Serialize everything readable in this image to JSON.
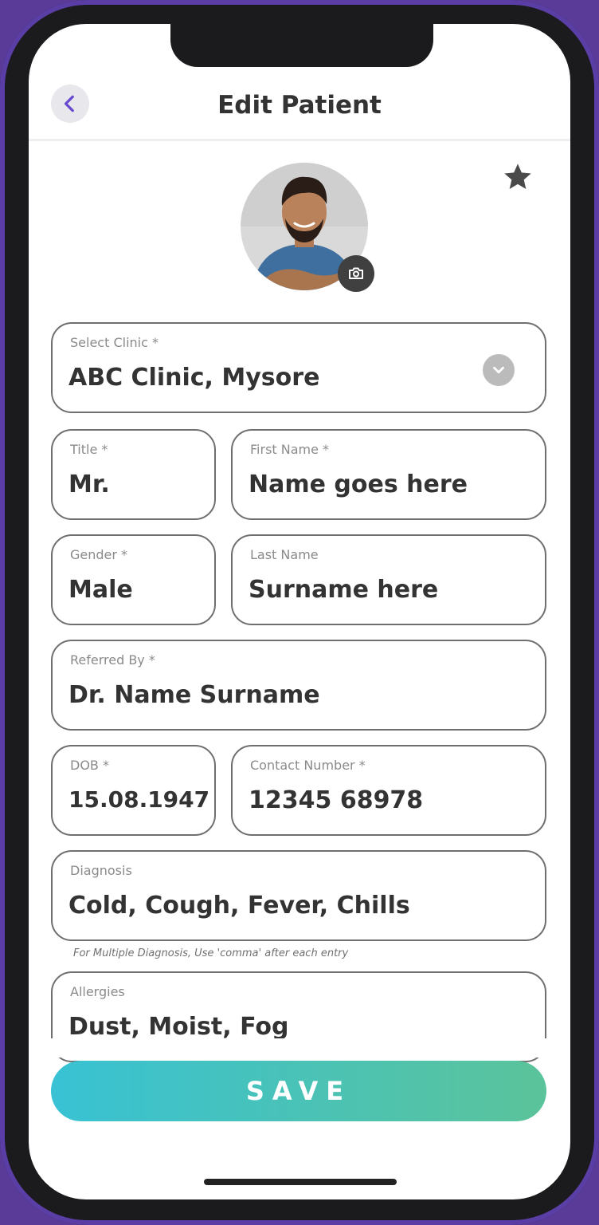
{
  "header": {
    "title": "Edit Patient"
  },
  "form": {
    "clinic": {
      "label": "Select Clinic *",
      "value": "ABC Clinic, Mysore"
    },
    "title": {
      "label": "Title *",
      "value": "Mr."
    },
    "first_name": {
      "label": "First Name *",
      "value": "Name goes here"
    },
    "gender": {
      "label": "Gender *",
      "value": "Male"
    },
    "last_name": {
      "label": "Last Name",
      "value": "Surname here"
    },
    "referred_by": {
      "label": "Referred By *",
      "value": "Dr. Name Surname"
    },
    "dob": {
      "label": "DOB *",
      "value": "15.08.1947"
    },
    "contact": {
      "label": "Contact Number *",
      "value": "12345 68978"
    },
    "diagnosis": {
      "label": "Diagnosis",
      "value": "Cold, Cough, Fever, Chills"
    },
    "diagnosis_hint": "For Multiple Diagnosis, Use 'comma' after each entry",
    "allergies": {
      "label": "Allergies",
      "value": "Dust, Moist, Fog"
    }
  },
  "actions": {
    "save_label": "SAVE"
  },
  "icons": {
    "back": "chevron-left-icon",
    "favorite": "star-icon",
    "camera": "camera-icon",
    "dropdown": "chevron-down-icon"
  },
  "colors": {
    "accent_purple": "#5b3b98",
    "save_gradient_start": "#38c2d4",
    "save_gradient_end": "#5bc39a"
  }
}
